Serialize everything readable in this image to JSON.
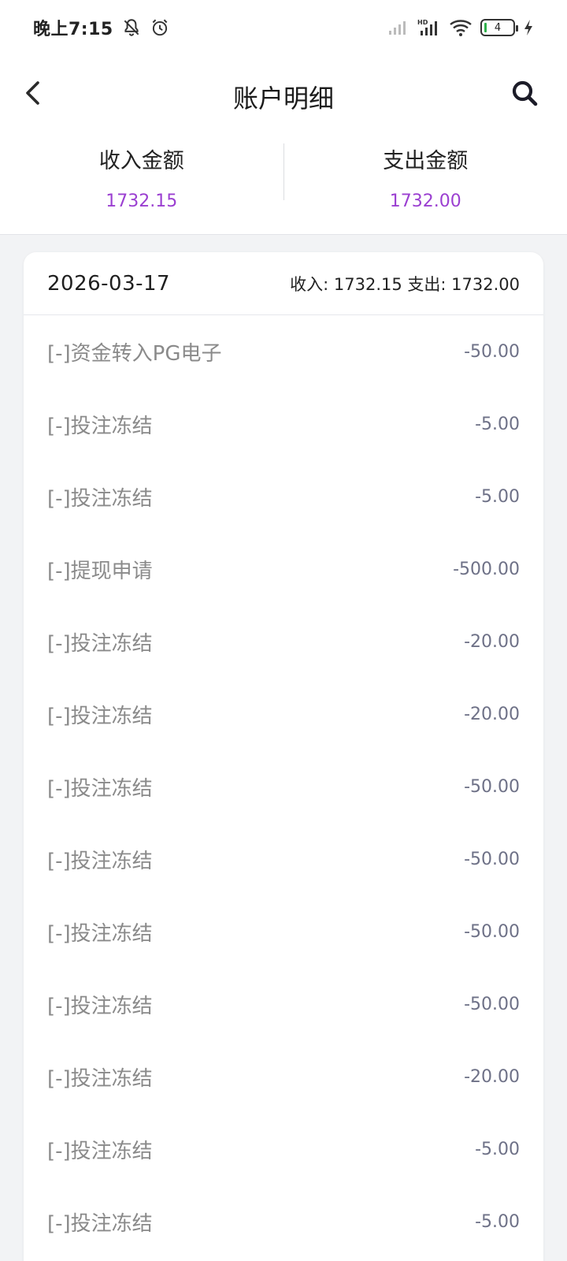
{
  "status_bar": {
    "time": "晚上7:15",
    "battery": "4",
    "icons": [
      "mute-icon",
      "alarm-icon",
      "signal-icon",
      "hd-signal-icon",
      "wifi-icon",
      "battery-icon",
      "charging-icon"
    ]
  },
  "nav": {
    "title": "账户明细",
    "back_icon": "chevron-left-icon",
    "search_icon": "search-icon"
  },
  "summary": {
    "income_label": "收入金额",
    "income_value": "1732.15",
    "expense_label": "支出金额",
    "expense_value": "1732.00"
  },
  "colors": {
    "accent": "#9b3fd1",
    "amount": "#6e7187",
    "label": "#8a8a8a"
  },
  "card": {
    "date": "2026-03-17",
    "totals": "收入: 1732.15 支出: 1732.00",
    "rows": [
      {
        "label": "[-]资金转入PG电子",
        "amount": "-50.00"
      },
      {
        "label": "[-]投注冻结",
        "amount": "-5.00"
      },
      {
        "label": "[-]投注冻结",
        "amount": "-5.00"
      },
      {
        "label": "[-]提现申请",
        "amount": "-500.00"
      },
      {
        "label": "[-]投注冻结",
        "amount": "-20.00"
      },
      {
        "label": "[-]投注冻结",
        "amount": "-20.00"
      },
      {
        "label": "[-]投注冻结",
        "amount": "-50.00"
      },
      {
        "label": "[-]投注冻结",
        "amount": "-50.00"
      },
      {
        "label": "[-]投注冻结",
        "amount": "-50.00"
      },
      {
        "label": "[-]投注冻结",
        "amount": "-50.00"
      },
      {
        "label": "[-]投注冻结",
        "amount": "-20.00"
      },
      {
        "label": "[-]投注冻结",
        "amount": "-5.00"
      },
      {
        "label": "[-]投注冻结",
        "amount": "-5.00"
      }
    ]
  }
}
